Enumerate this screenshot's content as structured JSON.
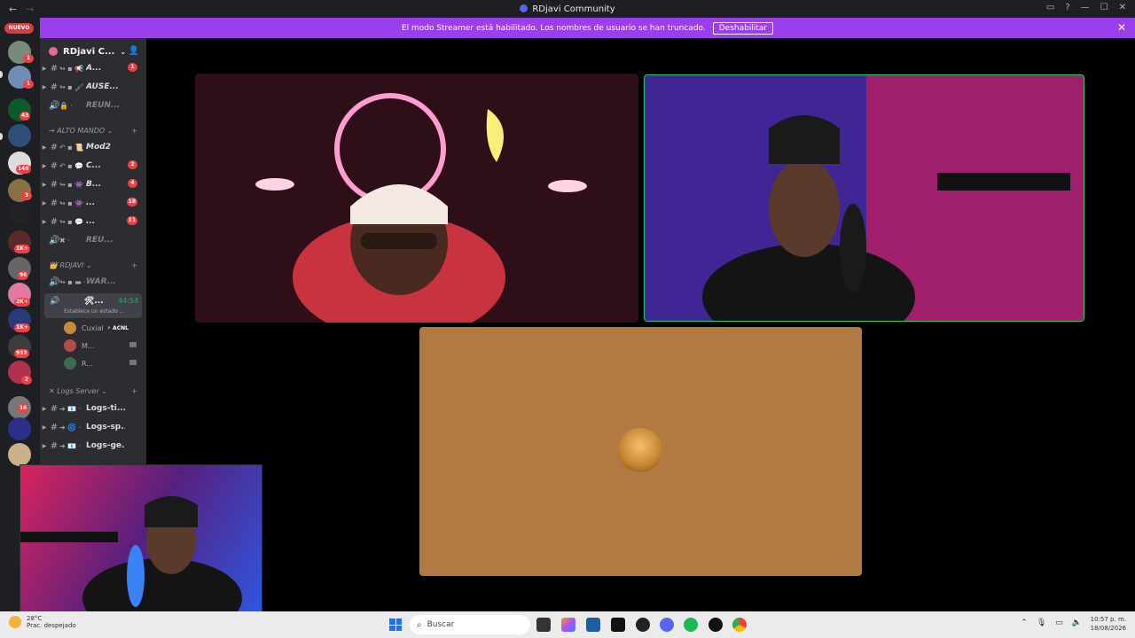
{
  "window": {
    "title": "RDjavi Community",
    "back_glyph": "←",
    "forward_glyph": "→"
  },
  "banner": {
    "text": "El modo Streamer está habilitado. Los nombres de usuario se han truncado.",
    "button": "Deshabilitar",
    "close": "✕"
  },
  "guilds": {
    "nuevo_top": "NUEVO",
    "badges": [
      "1",
      "1",
      "43",
      "149",
      "3",
      "1K+",
      "96",
      "2K+",
      "1K+",
      "933",
      "2",
      "16"
    ]
  },
  "server": {
    "name": "RDjavi C...",
    "channels_top": [
      {
        "prefix": "↬ ▪ 📢 ·",
        "name": "A...",
        "badge": "1"
      },
      {
        "prefix": "↬ ▪ 🖌 ·",
        "name": "AUSE...",
        "badge": ""
      },
      {
        "prefix": "🔒 ·",
        "name": "REUN...",
        "badge": ""
      }
    ],
    "category_alto": "ALTO MANDO",
    "channels_alto": [
      {
        "prefix": "↶ ▪ 📜 ·",
        "name": "Mod2",
        "badge": ""
      },
      {
        "prefix": "↶ ▪ 💬 ·",
        "name": "C...",
        "badge": "2"
      },
      {
        "prefix": "↬ ▪ 👾 ·",
        "name": "B...",
        "badge": "4"
      },
      {
        "prefix": "↬ ▪ 👾 ·",
        "name": "...",
        "badge": "18"
      },
      {
        "prefix": "↬ ▪ 💬 ·",
        "name": "...",
        "badge": "11"
      },
      {
        "prefix": "✖ ·",
        "name": "REU...",
        "badge": ""
      }
    ],
    "category_rdjavi": "RDJAVI",
    "channel_war": {
      "prefix": "↬ ▪ ▬ ·",
      "name": "WAR..."
    },
    "voice_active": {
      "name": "🛠...",
      "timer": "44:54",
      "status": "Establece un estado ..."
    },
    "voice_users": [
      {
        "name": "Cuxial",
        "tag": "⚡ ACNL",
        "avatar_color": "#c78a3a"
      },
      {
        "name": "M...",
        "tag": "",
        "avatar_color": "#b44a4a"
      },
      {
        "name": "R...",
        "tag": "",
        "avatar_color": "#3d6b4f"
      }
    ],
    "category_logs": "Logs Server",
    "channels_logs": [
      {
        "prefix": "➔ 📧 ·",
        "name": "Logs-ti..."
      },
      {
        "prefix": "➔ 🌀 ·",
        "name": "Logs-sp..."
      },
      {
        "prefix": "➔ 📧 ·",
        "name": "Logs-ge..."
      }
    ]
  },
  "taskbar": {
    "weather_temp": "28°C",
    "weather_desc": "Prac. despejado",
    "search_placeholder": "Buscar",
    "time": "10:57 p. m.",
    "date": "18/08/2026"
  },
  "colors": {
    "accent_banner": "#9b3fec",
    "speaking_border": "#23d16c",
    "badge_red": "#f23f43"
  }
}
